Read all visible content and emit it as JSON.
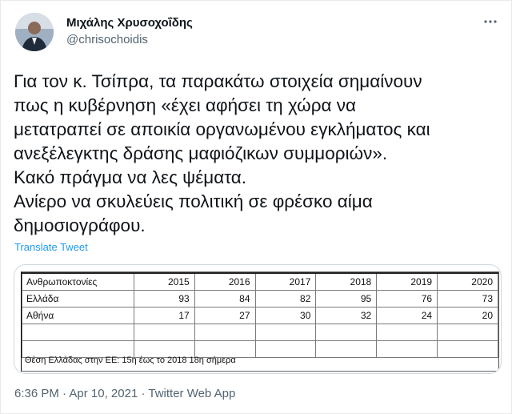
{
  "author": {
    "display_name": "Μιχάλης Χρυσοχοΐδης",
    "handle": "@chrisochoidis"
  },
  "tweet": {
    "lines": [
      "Για τον κ. Τσίπρα, τα παρακάτω στοιχεία σημαίνουν",
      "πως η κυβέρνηση «έχει αφήσει τη χώρα να",
      "μετατραπεί σε αποικία οργανωμένου εγκλήματος και",
      "ανεξέλεγκτης δράσης μαφιόζικων συμμοριών».",
      "Κακό πράγμα να λες ψέματα.",
      "Ανίερο να σκυλεύεις πολιτική σε φρέσκο αίμα",
      "δημοσιογράφου."
    ],
    "translate_label": "Translate Tweet"
  },
  "table": {
    "header_label": "Ανθρωποκτονίες",
    "years": [
      "2015",
      "2016",
      "2017",
      "2018",
      "2019",
      "2020"
    ],
    "rows": [
      {
        "label": "Ελλάδα",
        "values": [
          "93",
          "84",
          "82",
          "95",
          "76",
          "73"
        ]
      },
      {
        "label": "Αθήνα",
        "values": [
          "17",
          "27",
          "30",
          "32",
          "24",
          "20"
        ]
      }
    ],
    "note": "Θέση Ελλάδας στην ΕΕ: 15η έως το 2018 18η σήμερα"
  },
  "meta": {
    "time": "6:36 PM",
    "sep1": " · ",
    "date": "Apr 10, 2021",
    "sep2": " · ",
    "app": "Twitter Web App"
  },
  "icons": {
    "more": "more-dots-icon",
    "avatar": "avatar"
  },
  "colors": {
    "link": "#1d9bf0",
    "secondary_text": "#536471",
    "primary_text": "#0f1419"
  }
}
